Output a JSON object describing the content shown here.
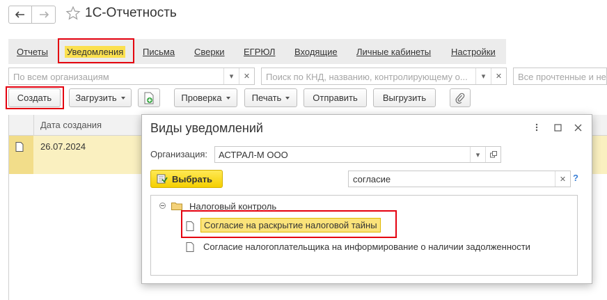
{
  "app": {
    "title": "1С-Отчетность"
  },
  "tabs": [
    {
      "label": "Отчеты",
      "active": false
    },
    {
      "label": "Уведомления",
      "active": true
    },
    {
      "label": "Письма",
      "active": false
    },
    {
      "label": "Сверки",
      "active": false
    },
    {
      "label": "ЕГРЮЛ",
      "active": false
    },
    {
      "label": "Входящие",
      "active": false
    },
    {
      "label": "Личные кабинеты",
      "active": false
    },
    {
      "label": "Настройки",
      "active": false
    }
  ],
  "filters": {
    "organization_placeholder": "По всем организациям",
    "search_placeholder": "Поиск по КНД, названию, контролирующему о...",
    "status_placeholder": "Все прочтенные и не"
  },
  "toolbar": {
    "create": "Создать",
    "load": "Загрузить",
    "check": "Проверка",
    "print": "Печать",
    "send": "Отправить",
    "export": "Выгрузить"
  },
  "table": {
    "columns": [
      "Дата создания"
    ],
    "rows": [
      {
        "date": "26.07.2024"
      }
    ]
  },
  "dialog": {
    "title": "Виды уведомлений",
    "org_label": "Организация:",
    "org_value": "АСТРАЛ-М ООО",
    "choose": "Выбрать",
    "search_value": "согласие",
    "help": "?",
    "tree": {
      "group": "Налоговый контроль",
      "items": [
        {
          "label": "Согласие на раскрытие налоговой тайны",
          "selected": true
        },
        {
          "label": "Согласие налогоплательщика на информирование о наличии задолженности",
          "selected": false
        }
      ]
    }
  },
  "colors": {
    "accent": "#fbe04f",
    "highlight": "#e4000f",
    "selection": "#fbe37a"
  }
}
